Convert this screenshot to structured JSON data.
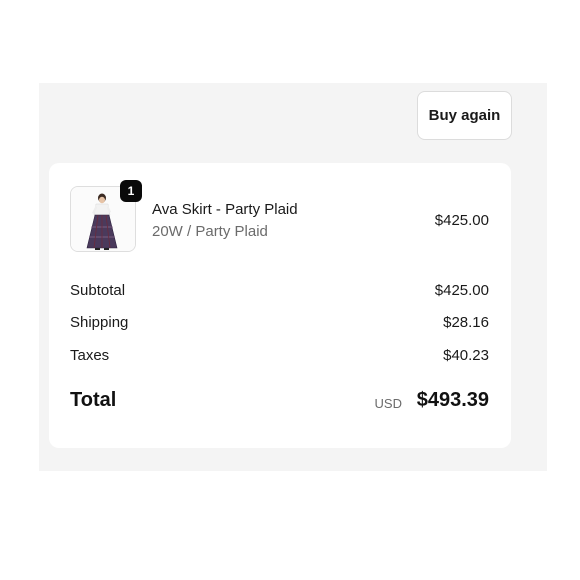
{
  "actions": {
    "buy_again_label": "Buy again"
  },
  "line_item": {
    "quantity": "1",
    "name": "Ava Skirt - Party Plaid",
    "variant": "20W / Party Plaid",
    "price": "$425.00",
    "image_icon": "product-photo-skirt"
  },
  "summary": {
    "subtotal_label": "Subtotal",
    "subtotal_value": "$425.00",
    "shipping_label": "Shipping",
    "shipping_value": "$28.16",
    "taxes_label": "Taxes",
    "taxes_value": "$40.23",
    "total_label": "Total",
    "total_currency": "USD",
    "total_value": "$493.39"
  },
  "colors": {
    "panel_bg": "#f4f4f4",
    "card_bg": "#ffffff",
    "badge_bg": "#0a0a0a",
    "muted_text": "#6b6b6b"
  }
}
